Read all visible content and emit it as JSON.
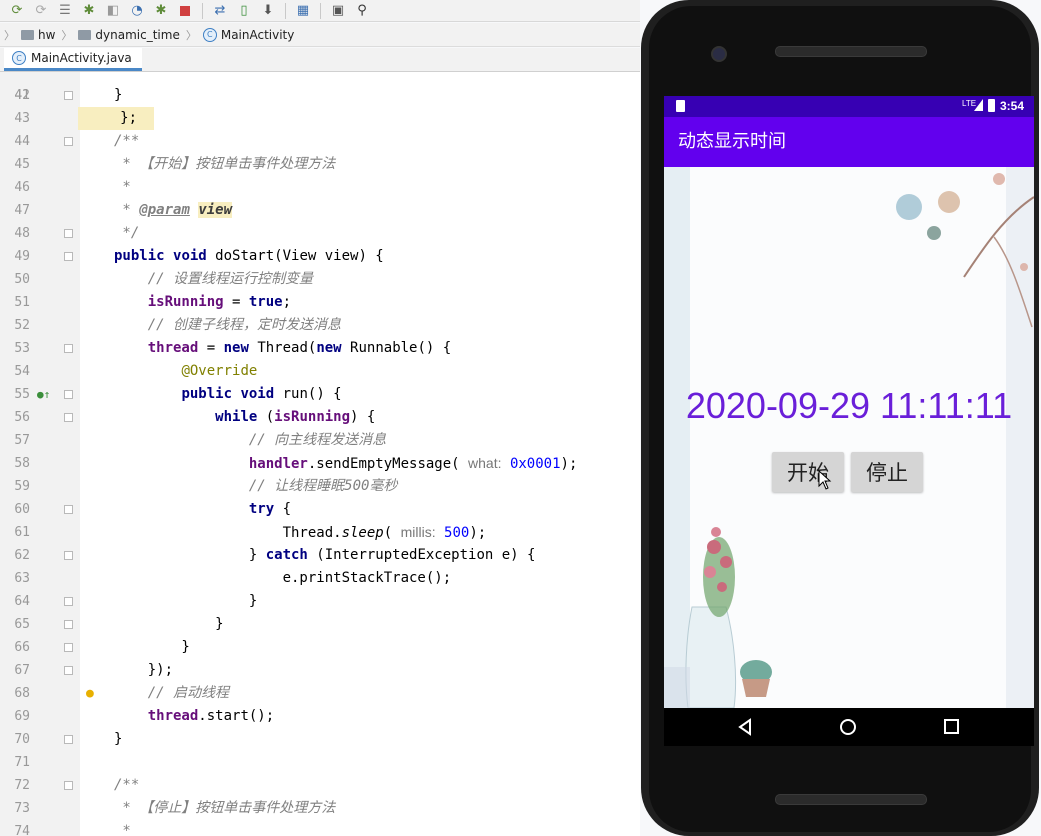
{
  "breadcrumb": {
    "items": [
      "hw",
      "dynamic_time",
      "MainActivity"
    ]
  },
  "tab": {
    "label": "MainActivity.java"
  },
  "editor": {
    "lines": [
      {
        "n": "42",
        "code": "}"
      },
      {
        "n": "43",
        "code": ""
      },
      {
        "n": "44",
        "code": "/**"
      },
      {
        "n": "45",
        "code": " * 【开始】按钮单击事件处理方法"
      },
      {
        "n": "46",
        "code": " *"
      },
      {
        "n": "47",
        "code": " * @param view"
      },
      {
        "n": "48",
        "code": " */"
      },
      {
        "n": "49",
        "code": "public void doStart(View view) {"
      },
      {
        "n": "50",
        "code": "    // 设置线程运行控制变量"
      },
      {
        "n": "51",
        "code": "    isRunning = true;"
      },
      {
        "n": "52",
        "code": "    // 创建子线程，定时发送消息"
      },
      {
        "n": "53",
        "code": "    thread = new Thread(new Runnable() {"
      },
      {
        "n": "54",
        "code": "        @Override"
      },
      {
        "n": "55",
        "code": "        public void run() {"
      },
      {
        "n": "56",
        "code": "            while (isRunning) {"
      },
      {
        "n": "57",
        "code": "                // 向主线程发送消息"
      },
      {
        "n": "58",
        "code": "                handler.sendEmptyMessage( what: 0x0001);"
      },
      {
        "n": "59",
        "code": "                // 让线程睡眠500毫秒"
      },
      {
        "n": "60",
        "code": "                try {"
      },
      {
        "n": "61",
        "code": "                    Thread.sleep( millis: 500);"
      },
      {
        "n": "62",
        "code": "                } catch (InterruptedException e) {"
      },
      {
        "n": "63",
        "code": "                    e.printStackTrace();"
      },
      {
        "n": "64",
        "code": "                }"
      },
      {
        "n": "65",
        "code": "            }"
      },
      {
        "n": "66",
        "code": "        }"
      },
      {
        "n": "67",
        "code": "    });"
      },
      {
        "n": "68",
        "code": "    // 启动线程"
      },
      {
        "n": "69",
        "code": "    thread.start();"
      },
      {
        "n": "70",
        "code": "}"
      },
      {
        "n": "71",
        "code": ""
      },
      {
        "n": "72",
        "code": "/**"
      },
      {
        "n": "73",
        "code": " * 【停止】按钮单击事件处理方法"
      },
      {
        "n": "74",
        "code": " *"
      }
    ]
  },
  "phone": {
    "status_net": "LTE",
    "status_time": "3:54",
    "app_title": "动态显示时间",
    "time_text": "2020-09-29 11:11:11",
    "start_button": "开始",
    "stop_button": "停止"
  },
  "colors": {
    "app_bar": "#6200ee",
    "status_bar": "#3700b3",
    "time_text": "#6a1fd9",
    "keyword": "#000080",
    "comment": "#808080"
  }
}
